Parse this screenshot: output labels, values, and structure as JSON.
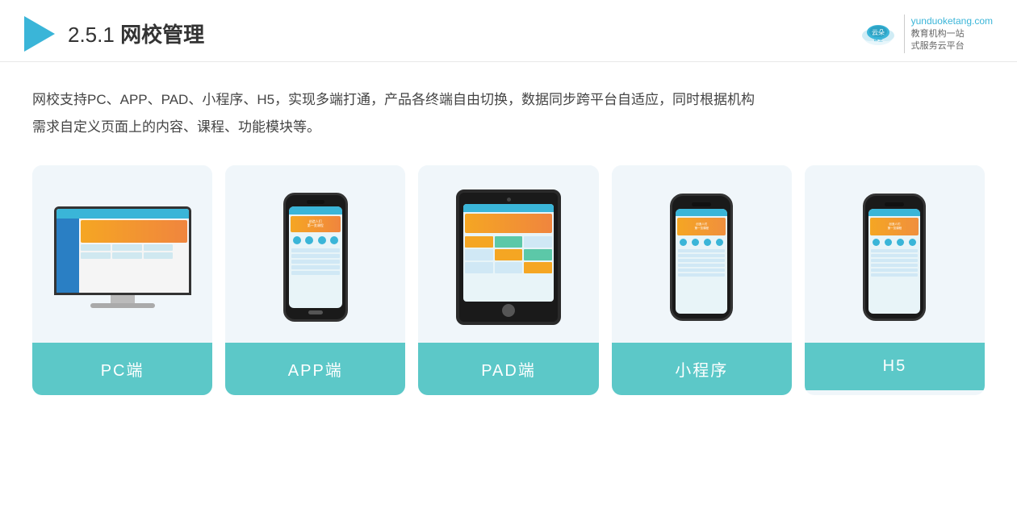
{
  "header": {
    "section": "2.5.1",
    "title": "网校管理",
    "brand": {
      "site": "yunduoketang.com",
      "tagline1": "教育机构一站",
      "tagline2": "式服务云平台"
    }
  },
  "description": {
    "line1": "网校支持PC、APP、PAD、小程序、H5，实现多端打通，产品各终端自由切换，数据同步跨平台自适应，同时根据机构",
    "line2": "需求自定义页面上的内容、课程、功能模块等。"
  },
  "cards": [
    {
      "id": "pc",
      "label": "PC端"
    },
    {
      "id": "app",
      "label": "APP端"
    },
    {
      "id": "pad",
      "label": "PAD端"
    },
    {
      "id": "miniprogram",
      "label": "小程序"
    },
    {
      "id": "h5",
      "label": "H5"
    }
  ]
}
